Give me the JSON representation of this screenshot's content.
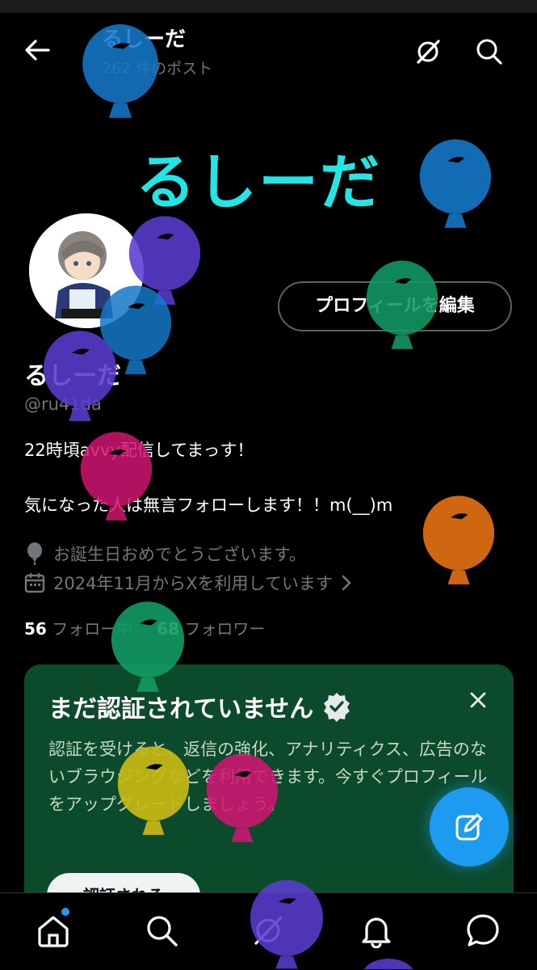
{
  "header": {
    "title": "るしーだ",
    "post_count": "262 件のポスト",
    "back_icon": "arrow-left-icon",
    "grok_icon": "grok-icon",
    "search_icon": "search-icon"
  },
  "banner": {
    "text": "るしーだ",
    "color": "#22e5e5"
  },
  "profile": {
    "edit_button": "プロフィールを編集",
    "display_name": "るしーだ",
    "handle": "@ru41da",
    "bio": "22時頃avvy配信してまっす！\n\n気になった人は無言フォローします！！m(__)m",
    "birthday": "お誕生日おめでとうございます。",
    "joined": "2024年11月からXを利用しています",
    "following_count": "56",
    "following_label": "フォロー中",
    "followers_count": "68",
    "followers_label": "フォロワー"
  },
  "verify_card": {
    "title": "まだ認証されていません",
    "body": "認証を受けると、返信の強化、アナリティクス、広告のないブラウジングなどを利用できます。今すぐプロフィールをアップグレードしましょう。",
    "button": "認証される",
    "background": "#0b4a2b"
  },
  "fab": {
    "icon": "compose-icon",
    "color": "#1d9bf0"
  },
  "bottom_nav": [
    "home-icon",
    "search-icon",
    "grok-icon",
    "notifications-icon",
    "messages-icon"
  ],
  "overlay": {
    "type": "balloons",
    "colors": [
      "#1478c8",
      "#5a3ccf",
      "#129a64",
      "#d01570",
      "#e07010",
      "#c8b814"
    ]
  }
}
